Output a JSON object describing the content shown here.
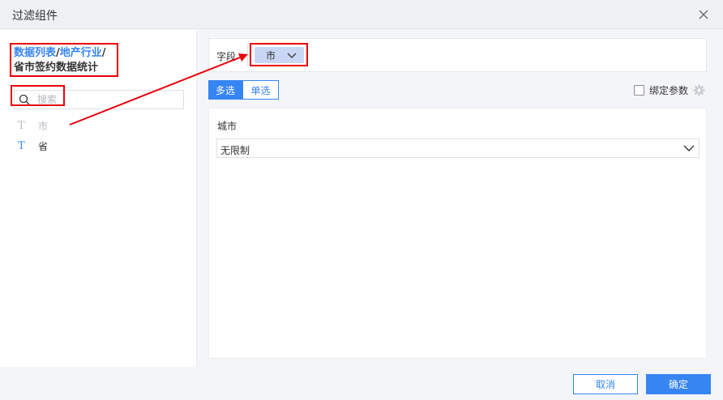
{
  "dialog": {
    "title": "过滤组件"
  },
  "left": {
    "datasource": {
      "list_link": "数据列表",
      "sep1": "/",
      "industry_link": "地产行业",
      "sep2": "/",
      "table_name": "省市签约数据统计"
    },
    "search": {
      "placeholder": "搜索"
    },
    "fields": [
      {
        "type_icon": "T",
        "label": "市",
        "disabled": true
      },
      {
        "type_icon": "T",
        "label": "省",
        "disabled": false
      }
    ]
  },
  "right": {
    "field_label": "字段",
    "selected_field": "市",
    "modes": {
      "multi": "多选",
      "single": "单选",
      "active": "multi"
    },
    "bind_param": {
      "label": "绑定参数",
      "checked": false
    },
    "config": {
      "label": "城市",
      "select_value": "无限制"
    }
  },
  "footer": {
    "cancel": "取消",
    "ok": "确定"
  },
  "colors": {
    "accent": "#3685f2",
    "annotation_red": "#e8000b",
    "chip_bg": "#c9d7f5"
  }
}
